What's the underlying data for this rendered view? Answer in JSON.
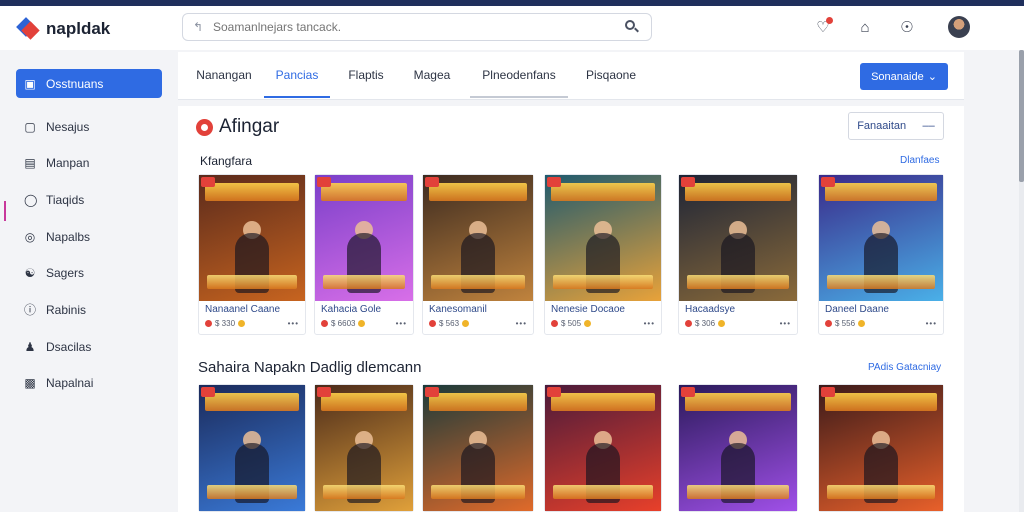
{
  "app": {
    "name": "napldak"
  },
  "search": {
    "placeholder": "Soamanlnejars tancack."
  },
  "topbar_icons": [
    "bell-icon",
    "home-icon",
    "help-icon"
  ],
  "sidebar": {
    "items": [
      {
        "label": "Osstnuans",
        "icon": "dashboard-icon",
        "active": true
      },
      {
        "label": "Nesajus",
        "icon": "checkbox-icon",
        "active": false
      },
      {
        "label": "Manpan",
        "icon": "marked-icon",
        "active": false
      },
      {
        "label": "Tiaqids",
        "icon": "tag-icon",
        "active": false
      },
      {
        "label": "Napalbs",
        "icon": "target-icon",
        "active": false
      },
      {
        "label": "Sagers",
        "icon": "users-icon",
        "active": false
      },
      {
        "label": "Rabinis",
        "icon": "info-icon",
        "active": false
      },
      {
        "label": "Dsacilas",
        "icon": "person-icon",
        "active": false
      },
      {
        "label": "Napalnai",
        "icon": "box-icon",
        "active": false
      }
    ]
  },
  "tabs": [
    {
      "label": "Nanangan",
      "state": "normal"
    },
    {
      "label": "Pancias",
      "state": "active"
    },
    {
      "label": "Flaptis",
      "state": "normal"
    },
    {
      "label": "Magea",
      "state": "normal"
    },
    {
      "label": "Plneodenfans",
      "state": "underlined"
    },
    {
      "label": "Pisqaone",
      "state": "normal"
    }
  ],
  "primary_button": {
    "label": "Sonanaide"
  },
  "section": {
    "title": "Afingar",
    "select_label": "Fanaaitan",
    "row1": {
      "label": "Kfangfara",
      "link": "Dlanfaes"
    },
    "row2": {
      "label": "Sahaira Napakn Dadlig dlemcann",
      "link": "PAdis Gatacniay"
    }
  },
  "cards_row1": [
    {
      "title": "Nanaanel Caane",
      "rating": "$ 330",
      "colors": [
        "#5a2a1c",
        "#c7641f"
      ]
    },
    {
      "title": "Kahacia Gole",
      "rating": "$ 6603",
      "colors": [
        "#7a3fc9",
        "#d86fe8"
      ]
    },
    {
      "title": "Kanesomanil",
      "rating": "$ 563",
      "colors": [
        "#3b2a20",
        "#c0833d"
      ]
    },
    {
      "title": "Nenesie Docaoe",
      "rating": "$ 505",
      "colors": [
        "#1f5a6e",
        "#e8a23a"
      ]
    },
    {
      "title": "Hacaadsye",
      "rating": "$ 306",
      "colors": [
        "#1d2436",
        "#8a6a3a"
      ]
    },
    {
      "title": "Daneel Daane",
      "rating": "$ 556",
      "colors": [
        "#3a2a8a",
        "#4ab0e8"
      ]
    }
  ],
  "cards_row2": [
    {
      "colors": [
        "#1b2a5a",
        "#3a7ad8"
      ]
    },
    {
      "colors": [
        "#4a2a1a",
        "#e0a03a"
      ]
    },
    {
      "colors": [
        "#1a3a3a",
        "#e06a2a"
      ]
    },
    {
      "colors": [
        "#4a1a3a",
        "#e8402a"
      ]
    },
    {
      "colors": [
        "#2a1a5a",
        "#a050e8"
      ]
    },
    {
      "colors": [
        "#3a1a1a",
        "#e8602a"
      ]
    }
  ]
}
